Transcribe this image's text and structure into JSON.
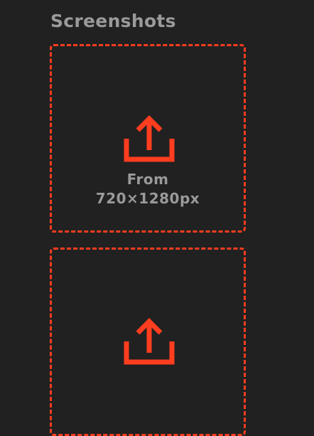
{
  "section": {
    "title": "Screenshots"
  },
  "dropzones": [
    {
      "icon": "upload-icon",
      "hint_line1": "From",
      "hint_line2": "720×1280px"
    },
    {
      "icon": "upload-icon"
    }
  ],
  "colors": {
    "background": "#212121",
    "accent": "#ff3d1f",
    "text": "#9a9a9a"
  }
}
